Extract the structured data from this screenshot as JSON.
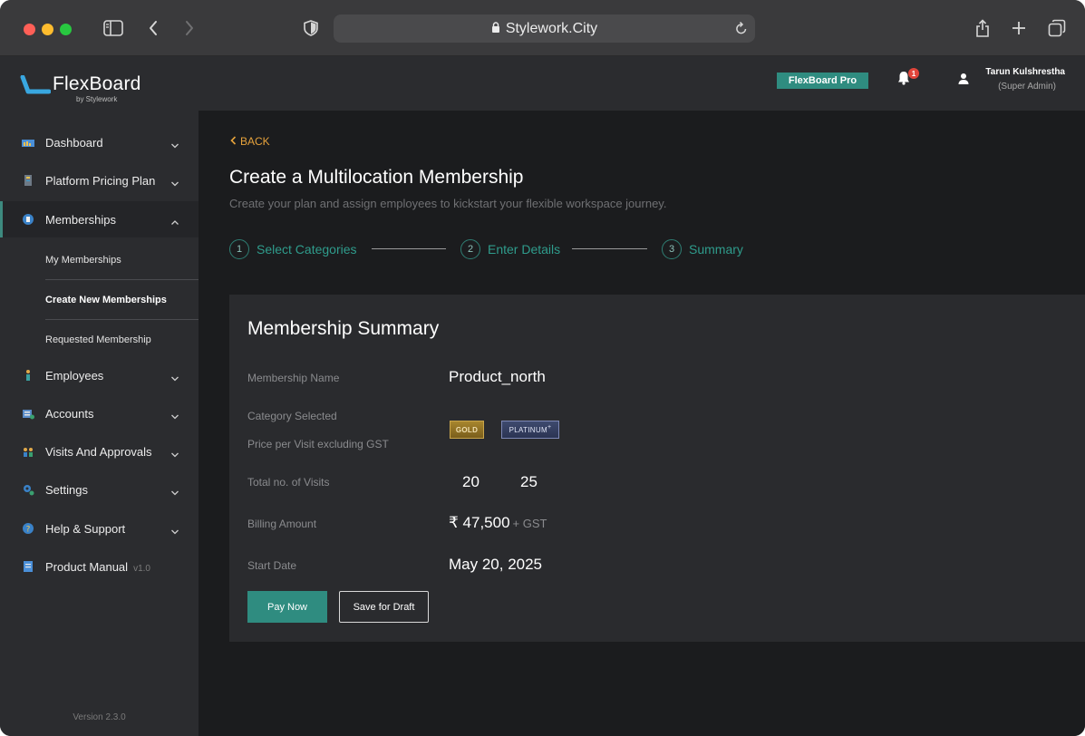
{
  "browser": {
    "url": "Stylework.City"
  },
  "header": {
    "logo_text": "FlexBoard",
    "logo_sub": "by Stylework",
    "plan_badge": "FlexBoard Pro",
    "notification_count": "1",
    "user_name": "Tarun Kulshrestha",
    "user_role": "(Super Admin)"
  },
  "sidebar": {
    "items": [
      {
        "label": "Dashboard",
        "icon": "dashboard-icon"
      },
      {
        "label": "Platform Pricing Plan",
        "icon": "pricing-icon"
      },
      {
        "label": "Memberships",
        "icon": "memberships-icon"
      },
      {
        "label": "Employees",
        "icon": "employees-icon"
      },
      {
        "label": "Accounts",
        "icon": "accounts-icon"
      },
      {
        "label": "Visits And Approvals",
        "icon": "visits-icon"
      },
      {
        "label": "Settings",
        "icon": "settings-icon"
      },
      {
        "label": "Help & Support",
        "icon": "help-icon"
      },
      {
        "label": "Product Manual",
        "icon": "manual-icon",
        "version": "v1.0"
      }
    ],
    "sub_items": [
      {
        "label": "My Memberships"
      },
      {
        "label": "Create New Memberships"
      },
      {
        "label": "Requested Membership"
      }
    ],
    "app_version": "Version 2.3.0"
  },
  "main": {
    "back_label": "BACK",
    "title": "Create a Multilocation Membership",
    "subtitle": "Create your plan and assign employees to kickstart your flexible workspace journey.",
    "steps": [
      {
        "num": "1",
        "label": "Select Categories"
      },
      {
        "num": "2",
        "label": "Enter Details"
      },
      {
        "num": "3",
        "label": "Summary"
      }
    ]
  },
  "summary": {
    "title": "Membership Summary",
    "membership_name_label": "Membership Name",
    "membership_name": "Product_north",
    "category_label": "Category Selected",
    "price_label": "Price per Visit excluding GST",
    "categories": [
      {
        "label": "GOLD"
      },
      {
        "label": "PLATINUM",
        "suffix": "+"
      }
    ],
    "visits_label": "Total no. of Visits",
    "visits": [
      "20",
      "25"
    ],
    "billing_label": "Billing Amount",
    "billing_amount": "₹ 47,500",
    "billing_suffix": "+ GST",
    "start_label": "Start Date",
    "start_date": "May 20, 2025",
    "pay_button": "Pay Now",
    "draft_button": "Save for Draft"
  },
  "colors": {
    "accent": "#2f8c80",
    "back_link": "#e6a23c",
    "step_text": "#2f9c8c"
  }
}
